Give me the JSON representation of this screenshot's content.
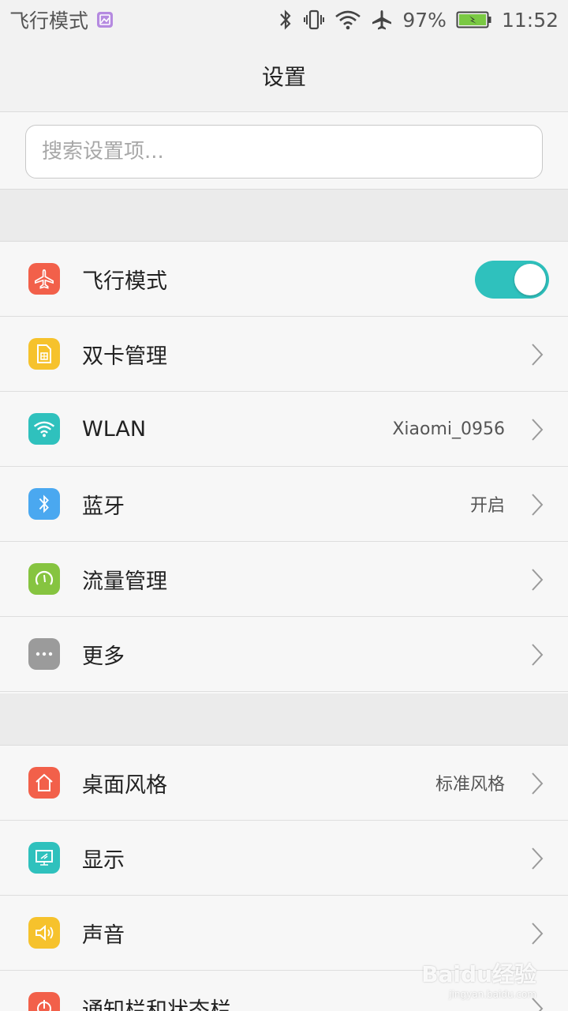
{
  "status_bar": {
    "left_text": "飞行模式",
    "battery": "97%",
    "time": "11:52"
  },
  "header": {
    "title": "设置"
  },
  "search": {
    "placeholder": "搜索设置项..."
  },
  "group1": {
    "items": [
      {
        "label": "飞行模式",
        "icon": "airplane-icon",
        "color": "#f2604a",
        "toggle": true
      },
      {
        "label": "双卡管理",
        "icon": "sim-card-icon",
        "color": "#f6c22c"
      },
      {
        "label": "WLAN",
        "icon": "wifi-icon",
        "color": "#2fc1bd",
        "value": "Xiaomi_0956"
      },
      {
        "label": "蓝牙",
        "icon": "bluetooth-icon",
        "color": "#4aa8f0",
        "value": "开启"
      },
      {
        "label": "流量管理",
        "icon": "data-usage-icon",
        "color": "#86c440"
      },
      {
        "label": "更多",
        "icon": "more-dots-icon",
        "color": "#9b9b9b"
      }
    ]
  },
  "group2": {
    "items": [
      {
        "label": "桌面风格",
        "icon": "home-icon",
        "color": "#f2604a",
        "value": "标准风格"
      },
      {
        "label": "显示",
        "icon": "display-icon",
        "color": "#2fc1bd"
      },
      {
        "label": "声音",
        "icon": "speaker-icon",
        "color": "#f6c22c"
      },
      {
        "label": "通知栏和状态栏",
        "icon": "notification-icon",
        "color": "#f2604a"
      }
    ]
  },
  "watermark": {
    "line1": "Baidu经验",
    "line2": "jingyan.baidu.com"
  },
  "colors": {
    "accent": "#2fc1bd",
    "background": "#f7f7f7",
    "section_gap": "#ebebeb"
  }
}
